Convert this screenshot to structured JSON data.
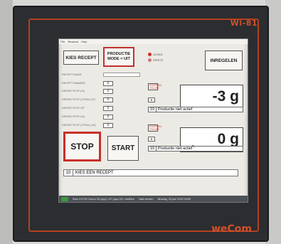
{
  "brand": {
    "model": "Wi-81",
    "name": "weCom"
  },
  "menubar": {
    "items": [
      "File",
      "Bestand",
      "Help"
    ]
  },
  "buttons": {
    "kies_recept": "KIES RECEPT",
    "productie_mode": "PRODUCTIE\nMODE = UIT",
    "inregelen": "INREGELEN",
    "stop": "STOP",
    "start": "START"
  },
  "indicators": [
    {
      "label": "LEGEN",
      "color": "#d32a2a"
    },
    {
      "label": "SPRITE",
      "color": "#c77777"
    }
  ],
  "form": {
    "recept_label": "RECEPT NAAM",
    "rows": [
      {
        "label": "RECEPT WAARDE",
        "value": "0"
      },
      {
        "label": "DROGE STOF (%)",
        "value": "0"
      },
      {
        "label": "DROGE STOF (TOTAL) KG",
        "value": "0"
      },
      {
        "label": "DROGE STOF OP",
        "value": "0"
      },
      {
        "label": "DROGE STOF (%)",
        "value": "0"
      },
      {
        "label": "DROGE STOF (TOTAL) (%)",
        "value": "0"
      }
    ]
  },
  "scale1": {
    "btn1": "STOPPEN",
    "btn2": "STOPPEN\nTOLLER",
    "zero": "0",
    "weight": "-3 g",
    "status_num": "10",
    "status_text": "Productie niet actief"
  },
  "scale2": {
    "btn1": "STOPPEN",
    "btn2": "STOPPEN\nTOLLER",
    "zero": "0",
    "weight": "0 g",
    "status_num": "10",
    "status_text": "Productie niet actief"
  },
  "bottom_status": {
    "num": "10",
    "text": "KIES EEN RECEPT"
  },
  "taskbar": {
    "left": "Step 212.99  Canon 33 (opp) / AT (opp-19) / wellbes",
    "middle": "Vaat version",
    "right": "dinsdag, 25 juni 2019 09:60"
  },
  "colors": {
    "accent_red": "#c8302a",
    "bezel": "#2b2d30",
    "brand_orange": "#d2502a"
  }
}
